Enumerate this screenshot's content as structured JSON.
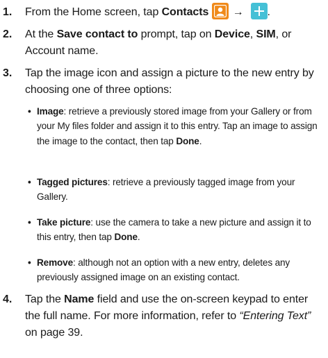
{
  "steps": [
    {
      "num": "1.",
      "a": "From the Home screen, tap ",
      "b_contacts": "Contacts",
      "arrow": "→",
      "end": "."
    },
    {
      "num": "2.",
      "a": "At the ",
      "b1": "Save contact to",
      "c": " prompt, tap on ",
      "b2": "Device",
      "d": ", ",
      "b3": "SIM",
      "e": ", or Account name."
    },
    {
      "num": "3.",
      "a": "Tap the image icon and assign a picture to the new entry by choosing one of three options:"
    },
    {
      "num": "4.",
      "a": "Tap the ",
      "b": "Name",
      "c": " field and use the on-screen keypad to enter the full name. For more information, refer to ",
      "ref": "“Entering Text”",
      "d": "  on page 39."
    }
  ],
  "options": [
    {
      "bullet": "•",
      "label": "Image",
      "text1": ": retrieve a previously stored image from your Gallery or from your My files folder and assign it to this entry. Tap an image to assign the image to the contact, then tap ",
      "done": "Done",
      "end": "."
    },
    {
      "bullet": "•",
      "label": "Tagged pictures",
      "text1": ": retrieve a previously tagged image from your Gallery."
    },
    {
      "bullet": "•",
      "label": "Take picture",
      "text1": ": use the camera to take a new picture and assign it to this entry, then tap ",
      "done": "Done",
      "end": "."
    },
    {
      "bullet": "•",
      "label": "Remove",
      "text1": ": although not an option with a new entry, deletes any previously assigned image on an existing contact."
    }
  ],
  "icons": {
    "contacts": "contacts-app-icon",
    "add": "plus-icon",
    "contacts_color": "#f08a1a",
    "add_color": "#45c0d6"
  }
}
